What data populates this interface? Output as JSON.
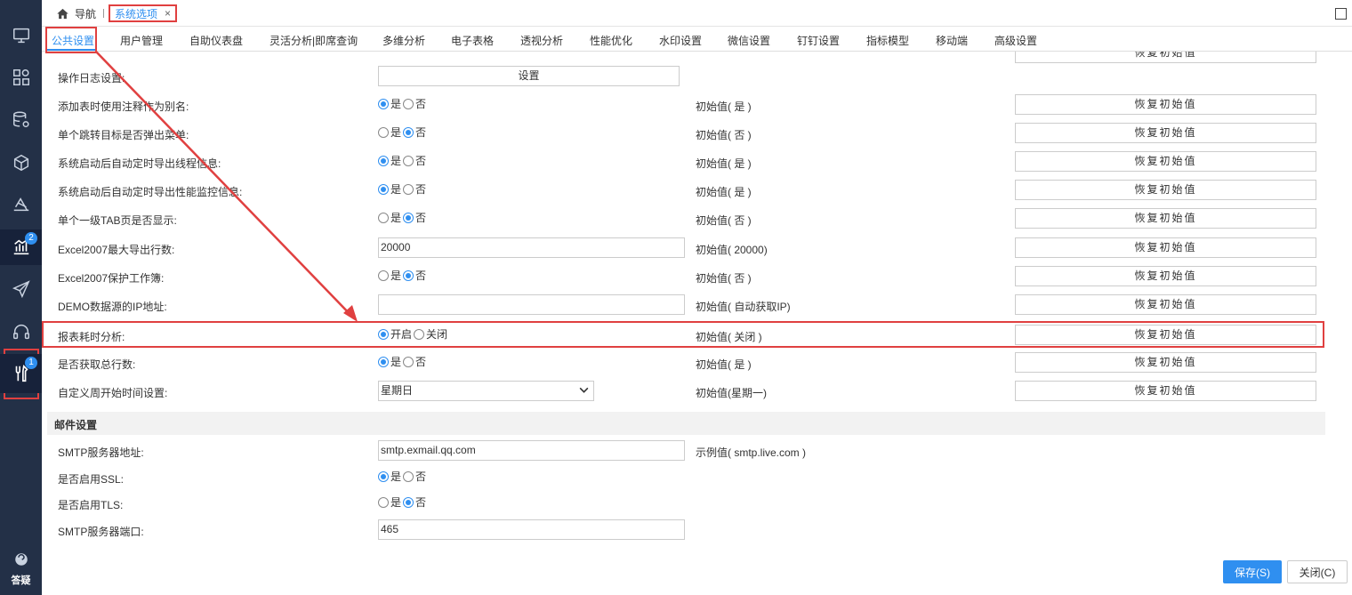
{
  "topbar": {
    "home_label": "导航",
    "active_tab_label": "系统选项",
    "close_glyph": "×"
  },
  "subnav": {
    "items": [
      "公共设置",
      "用户管理",
      "自助仪表盘",
      "灵活分析|即席查询",
      "多维分析",
      "电子表格",
      "透视分析",
      "性能优化",
      "水印设置",
      "微信设置",
      "钉钉设置",
      "指标模型",
      "移动端",
      "高级设置"
    ],
    "active_index": 0
  },
  "sidebar": {
    "icons": [
      "monitor-icon",
      "dashboard-grid-icon",
      "database-gear-icon",
      "cube-icon",
      "layers-icon",
      "analysis-chart-icon",
      "paper-plane-icon",
      "headset-icon",
      "tools-icon"
    ],
    "badge_analysis": "2",
    "badge_tools": "1",
    "help_label": "答疑"
  },
  "settings": {
    "log_label": "操作日志设置:",
    "log_button": "设置",
    "restore_label": "恢复初始值",
    "yes": "是",
    "no": "否",
    "on": "开启",
    "off": "关闭",
    "rows": [
      {
        "label": "添加表时使用注释作为别名:",
        "initial": "初始值( 是 )"
      },
      {
        "label": "单个跳转目标是否弹出菜单:",
        "initial": "初始值( 否 )"
      },
      {
        "label": "系统启动后自动定时导出线程信息:",
        "initial": "初始值( 是 )"
      },
      {
        "label": "系统启动后自动定时导出性能监控信息:",
        "initial": "初始值( 是 )"
      },
      {
        "label": "单个一级TAB页是否显示:",
        "initial": "初始值( 否 )"
      },
      {
        "label": "Excel2007最大导出行数:",
        "initial": "初始值( 20000)",
        "value": "20000"
      },
      {
        "label": "Excel2007保护工作簿:",
        "initial": "初始值( 否 )"
      },
      {
        "label": "DEMO数据源的IP地址:",
        "initial": "初始值( 自动获取IP)",
        "value": ""
      },
      {
        "label": "报表耗时分析:",
        "initial": "初始值( 关闭 )"
      },
      {
        "label": "是否获取总行数:",
        "initial": "初始值( 是 )"
      },
      {
        "label": "自定义周开始时间设置:",
        "initial": "初始值(星期一)",
        "value": "星期日"
      }
    ]
  },
  "mail": {
    "section_title": "邮件设置",
    "smtp_label": "SMTP服务器地址:",
    "smtp_value": "smtp.exmail.qq.com",
    "smtp_example": "示例值( smtp.live.com )",
    "ssl_label": "是否启用SSL:",
    "tls_label": "是否启用TLS:",
    "port_label": "SMTP服务器端口:",
    "port_value": "465"
  },
  "footer": {
    "save_label": "保存(S)",
    "close_label": "关闭(C)"
  },
  "colors": {
    "accent": "#2f8ff0",
    "sidebar_bg": "#233047",
    "highlight": "#e04040"
  }
}
